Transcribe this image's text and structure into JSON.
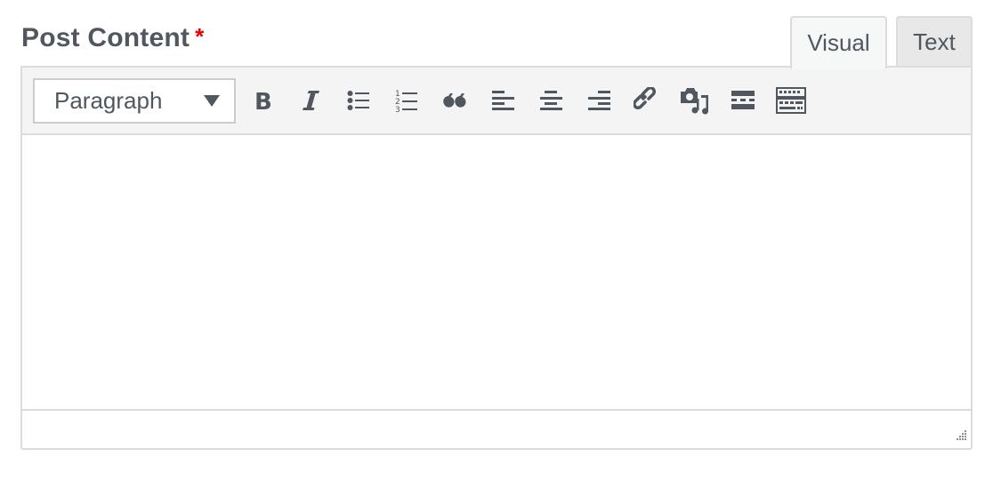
{
  "field": {
    "label": "Post Content",
    "required_marker": "*"
  },
  "tabs": [
    {
      "label": "Visual",
      "active": true
    },
    {
      "label": "Text",
      "active": false
    }
  ],
  "toolbar": {
    "format_select": {
      "value": "Paragraph"
    },
    "buttons": [
      {
        "name": "bold",
        "icon": "bold-icon"
      },
      {
        "name": "italic",
        "icon": "italic-icon"
      },
      {
        "name": "bulleted-list",
        "icon": "bulleted-list-icon"
      },
      {
        "name": "numbered-list",
        "icon": "numbered-list-icon"
      },
      {
        "name": "blockquote",
        "icon": "blockquote-icon"
      },
      {
        "name": "align-left",
        "icon": "align-left-icon"
      },
      {
        "name": "align-center",
        "icon": "align-center-icon"
      },
      {
        "name": "align-right",
        "icon": "align-right-icon"
      },
      {
        "name": "insert-link",
        "icon": "link-icon"
      },
      {
        "name": "add-media",
        "icon": "media-icon"
      },
      {
        "name": "insert-read-more",
        "icon": "read-more-icon"
      },
      {
        "name": "toolbar-toggle",
        "icon": "keyboard-icon"
      }
    ]
  },
  "editor": {
    "content": ""
  },
  "colors": {
    "text": "#50575e",
    "required": "#ee0000",
    "border": "#dcdcde",
    "toolbar_bg": "#f4f4f4"
  }
}
